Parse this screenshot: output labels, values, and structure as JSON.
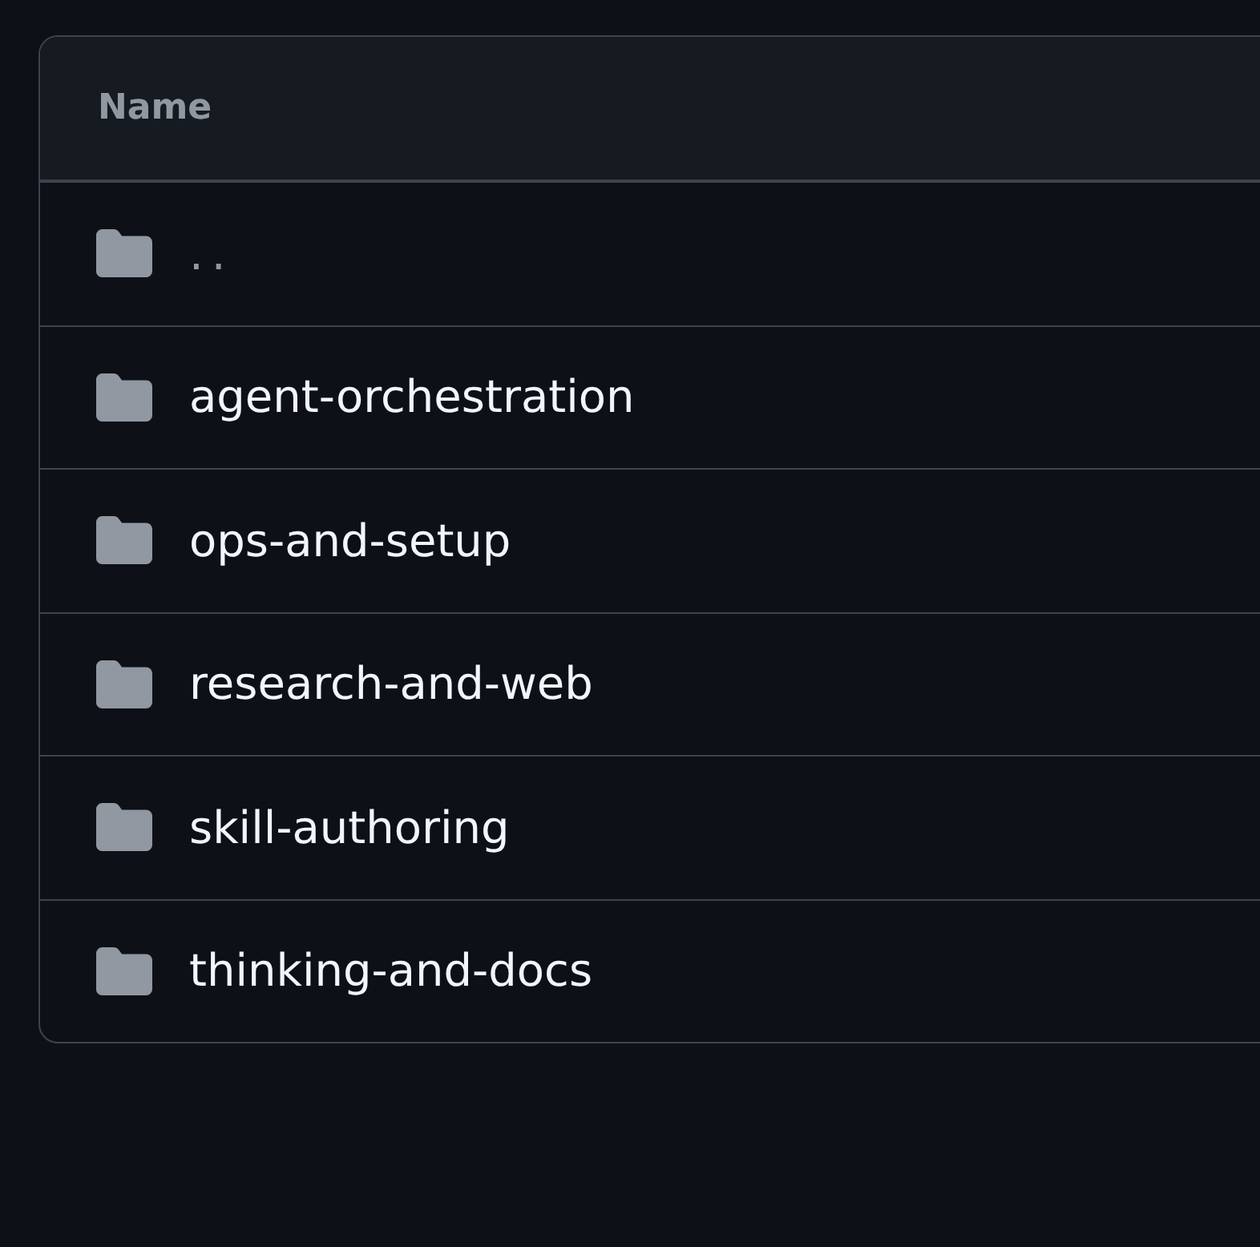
{
  "table": {
    "columns": [
      {
        "label": "Name"
      }
    ],
    "rows": [
      {
        "kind": "parent",
        "name": ".."
      },
      {
        "kind": "folder",
        "name": "agent-orchestration"
      },
      {
        "kind": "folder",
        "name": "ops-and-setup"
      },
      {
        "kind": "folder",
        "name": "research-and-web"
      },
      {
        "kind": "folder",
        "name": "skill-authoring"
      },
      {
        "kind": "folder",
        "name": "thinking-and-docs"
      }
    ]
  }
}
